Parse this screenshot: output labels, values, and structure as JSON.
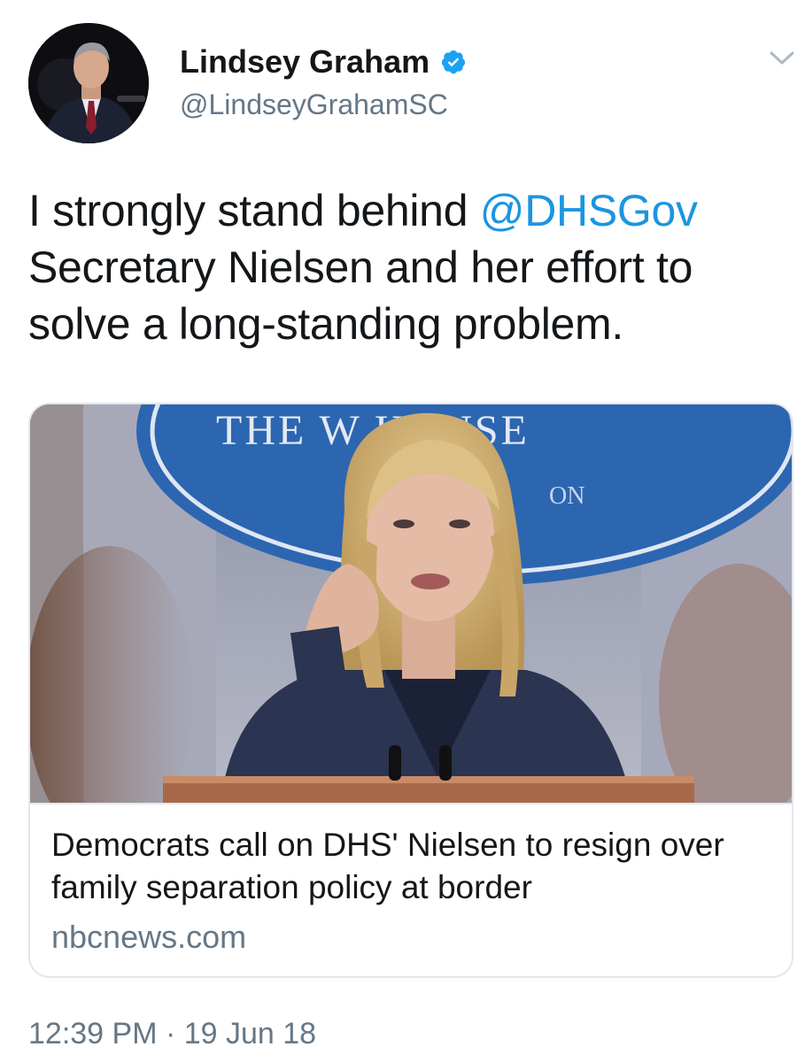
{
  "author": {
    "display_name": "Lindsey Graham",
    "handle": "@LindseyGrahamSC",
    "verified": true,
    "verified_icon": "verified-badge-icon",
    "avatar_icon": "profile-photo"
  },
  "menu": {
    "icon": "chevron-down-icon"
  },
  "tweet": {
    "text_before": "I strongly stand behind ",
    "mention": "@DHSGov",
    "text_after": " Secretary Nielsen and her effort to solve a long-standing problem."
  },
  "card": {
    "image_sign_text": "THE W    HOUSE",
    "image_sign_subtext": "ON",
    "title": "Democrats call on DHS' Nielsen to resign over family separation policy at border",
    "domain": "nbcnews.com"
  },
  "footer": {
    "timestamp": "12:39 PM · 19 Jun 18"
  },
  "colors": {
    "link": "#1b95e0",
    "secondary_text": "#657786",
    "primary_text": "#14171a",
    "border": "#e1e8ed"
  }
}
